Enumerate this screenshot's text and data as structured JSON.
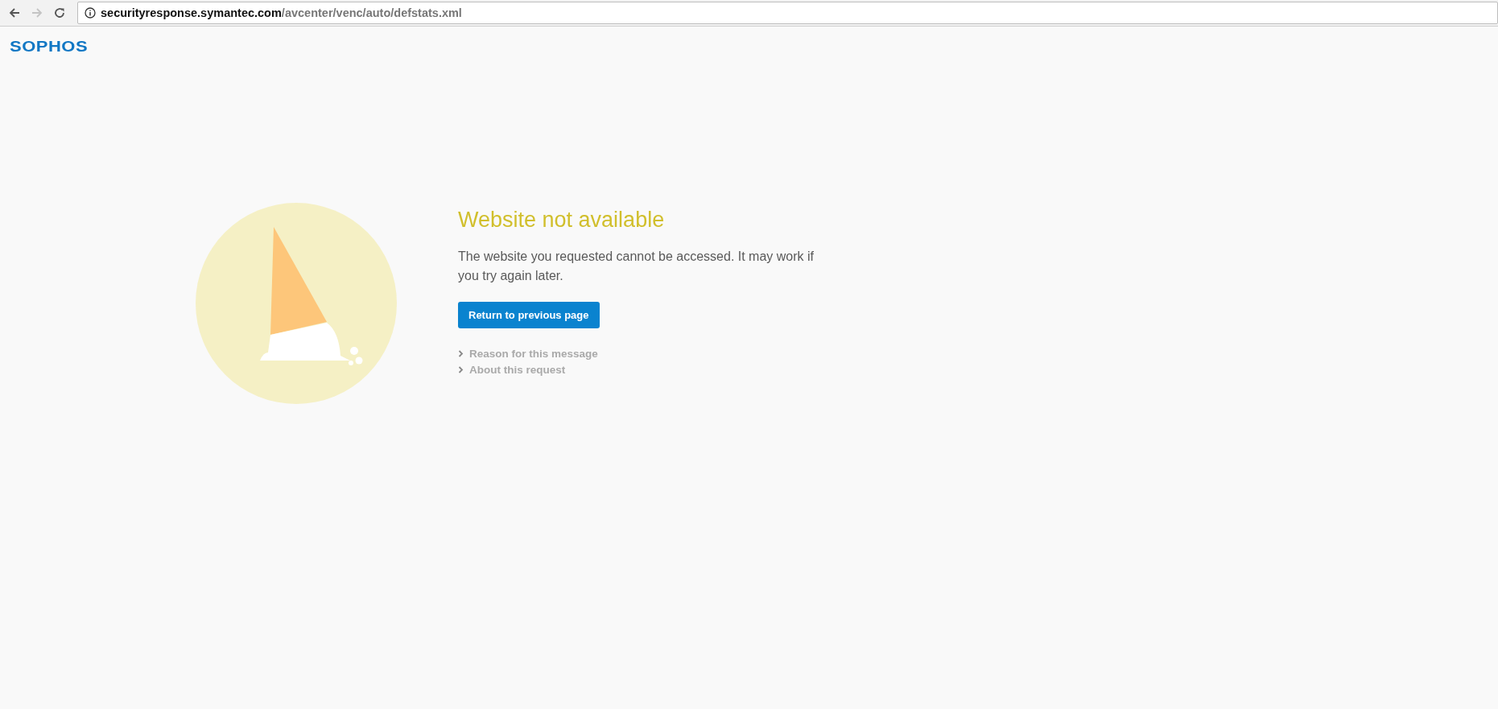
{
  "browser": {
    "url_host": "securityresponse.symantec.com",
    "url_path": "/avcenter/venc/auto/defstats.xml",
    "forward_disabled": true
  },
  "logo": "SOPHOS",
  "error": {
    "title": "Website not available",
    "message": "The website you requested cannot be accessed. It may work if you try again later.",
    "button": "Return to previous page",
    "links": [
      {
        "label": "Reason for this message",
        "expanded": false
      },
      {
        "label": "About this request",
        "expanded": false
      }
    ]
  }
}
